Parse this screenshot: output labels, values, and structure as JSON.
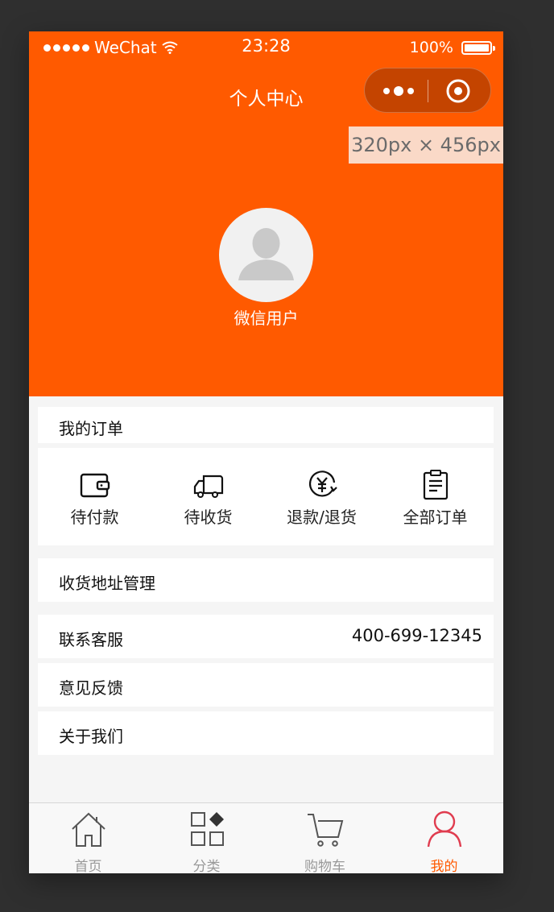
{
  "status_bar": {
    "signal_dots": 5,
    "carrier": "WeChat",
    "time": "23:28",
    "battery": "100%"
  },
  "nav": {
    "title": "个人中心"
  },
  "dimension_tag": "320px × 456px",
  "profile": {
    "username": "微信用户"
  },
  "orders": {
    "title": "我的订单",
    "items": [
      {
        "label": "待付款",
        "icon": "wallet-icon"
      },
      {
        "label": "待收货",
        "icon": "truck-icon"
      },
      {
        "label": "退款/退货",
        "icon": "refund-icon"
      },
      {
        "label": "全部订单",
        "icon": "clipboard-icon"
      }
    ]
  },
  "menu": {
    "address": "收货地址管理",
    "service_label": "联系客服",
    "service_phone": "400-699-12345",
    "feedback": "意见反馈",
    "about": "关于我们"
  },
  "tabbar": {
    "items": [
      {
        "label": "首页",
        "icon": "home-icon"
      },
      {
        "label": "分类",
        "icon": "category-icon"
      },
      {
        "label": "购物车",
        "icon": "cart-icon"
      },
      {
        "label": "我的",
        "icon": "user-icon",
        "active": true
      }
    ]
  },
  "colors": {
    "accent": "#ff5a00",
    "active_tab_icon": "#e03c4f",
    "background": "#f5f5f5"
  }
}
